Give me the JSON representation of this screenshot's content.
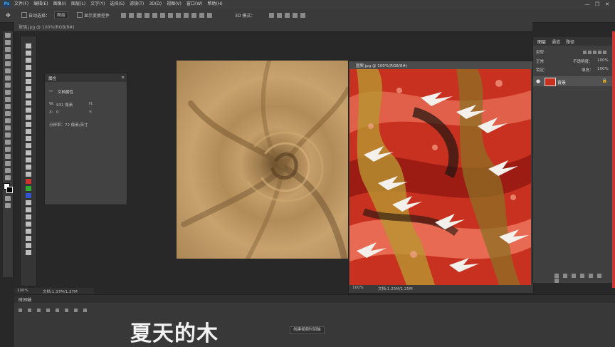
{
  "app": {
    "logo": "Ps",
    "window_controls": [
      "—",
      "❐",
      "✕"
    ]
  },
  "menu": [
    "文件(F)",
    "编辑(E)",
    "图像(I)",
    "图层(L)",
    "文字(Y)",
    "选择(S)",
    "滤镜(T)",
    "3D(D)",
    "视图(V)",
    "窗口(W)",
    "帮助(H)"
  ],
  "options": {
    "auto_select_label": "自动选择：",
    "auto_select_value": "图层",
    "show_transform_label": "显示变换控件",
    "mode_label": "3D 模式："
  },
  "doc_tab": {
    "title": "玻璃.jpg @ 100%(RGB/8#)"
  },
  "properties": {
    "tab": "属性",
    "title": "文档属性",
    "w_label": "W:",
    "w_value": "931 像素",
    "h_label": "H:",
    "x_label": "X:",
    "x_value": "0",
    "y_label": "Y:",
    "resolution": "分辨率：72 像素/英寸"
  },
  "window2": {
    "title": "图案.jpg @ 100%(RGB/8#)",
    "zoom": "100%",
    "doc_size": "文档:1.25M/1.25M"
  },
  "status1": {
    "zoom": "100%",
    "doc_size": "文档:1.37M/1.37M"
  },
  "layers": {
    "tabs": [
      "图层",
      "通道",
      "路径"
    ],
    "kind": "类型",
    "mode": "正常",
    "opacity_label": "不透明度：",
    "opacity_value": "100%",
    "lock_label": "锁定：",
    "fill_label": "填充：",
    "fill_value": "100%",
    "layer_name": "背景"
  },
  "timeline": {
    "title": "时间轴",
    "create_button": "创建视频时间轴"
  },
  "watermark": {
    "text": "夏天的木"
  },
  "colors": {
    "accent": "#31a8ff",
    "pattern_red": "#c8301f",
    "fabric": "#b8935e"
  }
}
